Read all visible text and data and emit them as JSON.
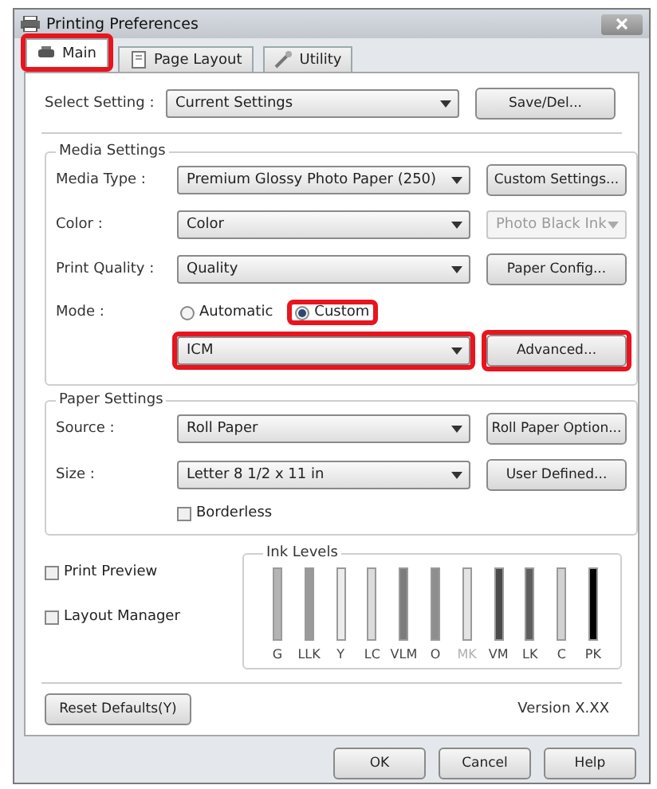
{
  "window": {
    "title": "Printing Preferences"
  },
  "tabs": [
    {
      "label": "Main",
      "selected": true,
      "highlighted": true
    },
    {
      "label": "Page Layout",
      "selected": false,
      "highlighted": false
    },
    {
      "label": "Utility",
      "selected": false,
      "highlighted": false
    }
  ],
  "select_setting": {
    "label": "Select Setting :",
    "value": "Current Settings",
    "button": "Save/Del..."
  },
  "media_settings": {
    "title": "Media Settings",
    "media_type": {
      "label": "Media Type :",
      "value": "Premium Glossy Photo Paper (250)"
    },
    "custom_settings_button": "Custom Settings...",
    "color": {
      "label": "Color :",
      "value": "Color"
    },
    "black_ink": {
      "value": "Photo Black Ink",
      "disabled": true
    },
    "print_quality": {
      "label": "Print Quality :",
      "value": "Quality"
    },
    "paper_config_button": "Paper Config...",
    "mode": {
      "label": "Mode :",
      "options": [
        {
          "label": "Automatic",
          "selected": false,
          "highlighted": false
        },
        {
          "label": "Custom",
          "selected": true,
          "highlighted": true
        }
      ]
    },
    "mode_setting": {
      "value": "ICM",
      "highlighted": true
    },
    "advanced_button": {
      "label": "Advanced...",
      "highlighted": true
    }
  },
  "paper_settings": {
    "title": "Paper Settings",
    "source": {
      "label": "Source :",
      "value": "Roll Paper"
    },
    "roll_paper_button": "Roll Paper Option...",
    "size": {
      "label": "Size :",
      "value": "Letter 8 1/2 x 11 in"
    },
    "user_defined_button": "User Defined...",
    "borderless": {
      "label": "Borderless",
      "checked": false
    }
  },
  "print_preview": {
    "label": "Print Preview",
    "checked": false
  },
  "layout_manager": {
    "label": "Layout Manager",
    "checked": false
  },
  "ink_levels": {
    "title": "Ink Levels",
    "inks": [
      {
        "label": "G",
        "color": "#b4b4b4",
        "level": 1,
        "disabled": false
      },
      {
        "label": "LLK",
        "color": "#9a9a9a",
        "level": 1,
        "disabled": false
      },
      {
        "label": "Y",
        "color": "#ececec",
        "level": 1,
        "disabled": false
      },
      {
        "label": "LC",
        "color": "#dcdcdc",
        "level": 1,
        "disabled": false
      },
      {
        "label": "VLM",
        "color": "#7c7c7c",
        "level": 1,
        "disabled": false
      },
      {
        "label": "O",
        "color": "#8e8e8e",
        "level": 1,
        "disabled": false
      },
      {
        "label": "MK",
        "color": "#e4e4e4",
        "level": 1,
        "disabled": true
      },
      {
        "label": "VM",
        "color": "#4a4a4a",
        "level": 1,
        "disabled": false
      },
      {
        "label": "LK",
        "color": "#5e5e5e",
        "level": 1,
        "disabled": false
      },
      {
        "label": "C",
        "color": "#d2d2d2",
        "level": 1,
        "disabled": false
      },
      {
        "label": "PK",
        "color": "#000000",
        "level": 1,
        "disabled": false
      }
    ]
  },
  "reset_button": "Reset Defaults(Y)",
  "version": "Version X.XX",
  "buttons": [
    "OK",
    "Cancel",
    "Help"
  ]
}
